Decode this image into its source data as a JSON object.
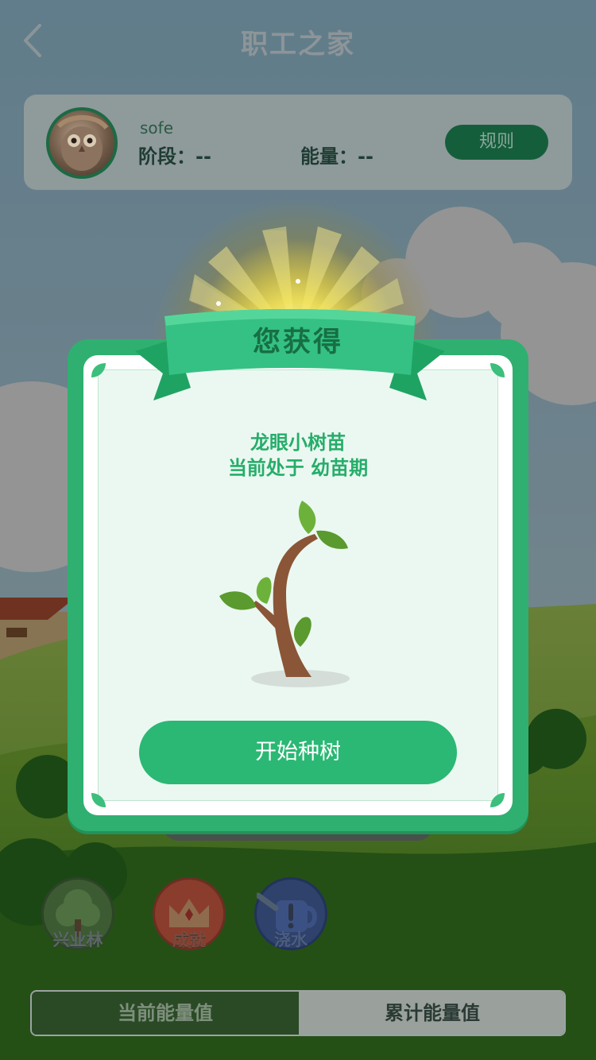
{
  "header": {
    "title": "职工之家"
  },
  "user": {
    "name": "sofe",
    "stage_label": "阶段：--",
    "energy_label": "能量：--",
    "rules_button": "规则"
  },
  "nav": {
    "forest": "兴业林",
    "achievement": "成就",
    "water": "浇水"
  },
  "tabs": {
    "current": "当前能量值",
    "total": "累计能量值"
  },
  "modal": {
    "heading": "您获得",
    "prize_name": "龙眼小树苗",
    "prize_stage": "当前处于 幼苗期",
    "start_button": "开始种树"
  },
  "colors": {
    "accent": "#2ab874",
    "dark_green": "#176f43",
    "modal_frame": "#2fb070"
  },
  "icons": {
    "back": "chevron-left-icon",
    "forest": "tree-icon",
    "achievement": "crown-icon",
    "water": "watering-can-icon",
    "prize": "sapling-icon"
  }
}
